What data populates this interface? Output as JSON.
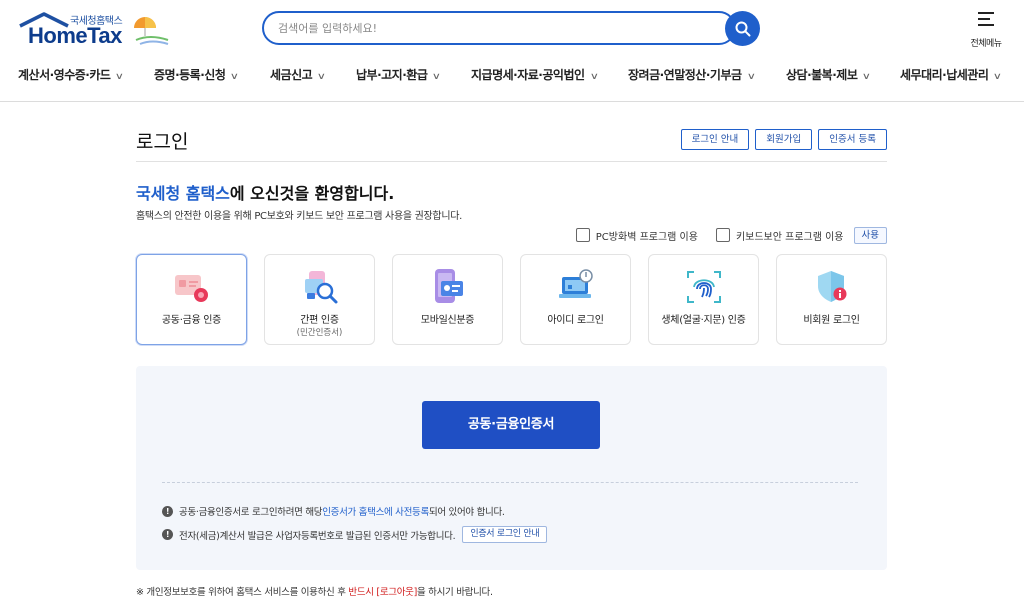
{
  "header": {
    "logo_small": "국세청홈택스",
    "logo_big": "HomeTax",
    "search_placeholder": "검색어를 입력하세요!",
    "all_menu_label": "전체메뉴"
  },
  "gnb": [
    {
      "label": "계산서·영수증·카드"
    },
    {
      "label": "증명·등록·신청"
    },
    {
      "label": "세금신고"
    },
    {
      "label": "납부·고지·환급"
    },
    {
      "label": "지급명세·자료·공익법인"
    },
    {
      "label": "장려금·연말정산·기부금"
    },
    {
      "label": "상담·불복·제보"
    },
    {
      "label": "세무대리·납세관리"
    }
  ],
  "page": {
    "title": "로그인",
    "buttons": [
      "로그인 안내",
      "회원가입",
      "인증서 등록"
    ],
    "welcome_highlight": "국세청 홈택스",
    "welcome_rest": "에 오신것을 환영합니다.",
    "welcome_sub": "홈택스의 안전한 이용을 위해 PC보호와 키보드 보안 프로그램 사용을 권장합니다.",
    "check_firewall": "PC방화벽 프로그램 이용",
    "check_keyboard": "키보드보안 프로그램 이용",
    "use_button": "사용"
  },
  "methods": [
    {
      "label": "공동·금융 인증",
      "sub": "",
      "icon": "cert-card-icon",
      "active": true
    },
    {
      "label": "간편 인증",
      "sub": "(민간인증서)",
      "icon": "magnifier-card-icon",
      "active": false
    },
    {
      "label": "모바일신분증",
      "sub": "",
      "icon": "mobile-id-icon",
      "active": false
    },
    {
      "label": "아이디 로그인",
      "sub": "",
      "icon": "laptop-id-icon",
      "active": false
    },
    {
      "label": "생체(얼굴·지문) 인증",
      "sub": "",
      "icon": "fingerprint-icon",
      "active": false
    },
    {
      "label": "비회원 로그인",
      "sub": "",
      "icon": "shield-info-icon",
      "active": false
    }
  ],
  "panel": {
    "cert_button": "공동·금융인증서",
    "notice1_pre": "공동·금융인증서로 로그인하려면 해당 ",
    "notice1_hl": "인증서가 홈택스에 사전등록",
    "notice1_post": "되어 있어야 합니다.",
    "notice2": "전자(세금)계산서 발급은 사업자등록번호로 발급된 인증서만 가능합니다.",
    "notice2_button": "인증서 로그인 안내"
  },
  "footnote": {
    "pre": "※ 개인정보보호를 위하여 홈택스 서비스를 이용하신 후 ",
    "red": "반드시 [로그아웃]",
    "post": "을 하시기 바랍니다."
  },
  "colors": {
    "primary": "#1f5fcb",
    "button": "#1f4fc4",
    "panel_bg": "#f3f6fb",
    "warning": "#d11b1b"
  }
}
